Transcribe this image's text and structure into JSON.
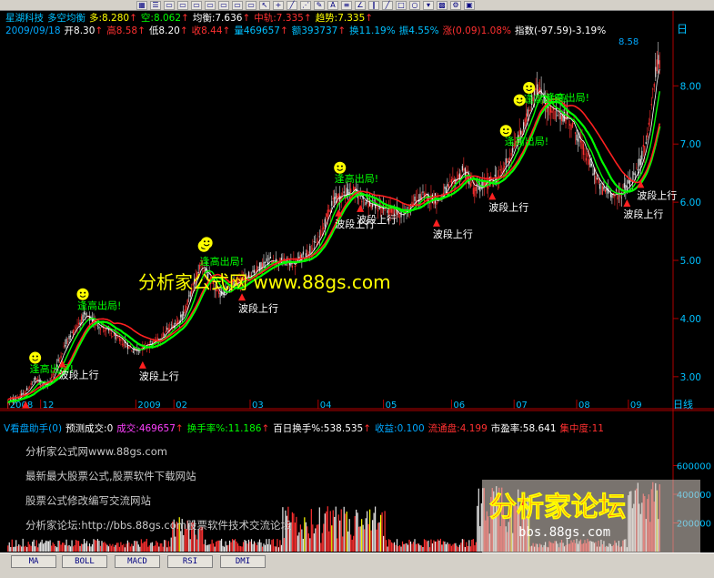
{
  "window": {
    "toolbar_icons": [
      "grid-icon",
      "list-icon",
      "window-icon",
      "window-icon",
      "window-icon",
      "window-icon",
      "window-icon",
      "window-icon",
      "window-icon",
      "pointer-icon",
      "cross-icon",
      "line-tool-icon",
      "fan-icon",
      "pen-icon",
      "text-icon",
      "channel-icon",
      "angle-icon",
      "parallel-icon",
      "line-tool-icon",
      "rect-icon",
      "circle-icon",
      "down-arrow-icon",
      "palette-icon",
      "settings-icon",
      "save-icon"
    ]
  },
  "header": {
    "row1": [
      {
        "text": "星湖科技",
        "color": "#00c0ff"
      },
      {
        "text": "多空均衡",
        "color": "#00c0ff"
      },
      {
        "text": "多:8.280",
        "color": "#ffff00"
      },
      {
        "text": "↑",
        "color": "#ff3030"
      },
      {
        "text": "空:8.062",
        "color": "#00ff00"
      },
      {
        "text": "↑",
        "color": "#ff3030"
      },
      {
        "text": "均衡:7.636",
        "color": "#ffffff"
      },
      {
        "text": "↑",
        "color": "#ff3030"
      },
      {
        "text": "中轨:7.335",
        "color": "#ff3030"
      },
      {
        "text": "↑",
        "color": "#ff3030"
      },
      {
        "text": "趋势:7.335",
        "color": "#ffff00"
      },
      {
        "text": "↑",
        "color": "#ff3030"
      }
    ],
    "row2": [
      {
        "text": "2009/09/18",
        "color": "#00a8ff"
      },
      {
        "text": "开8.30",
        "color": "#ffffff"
      },
      {
        "text": "↑",
        "color": "#ff3030"
      },
      {
        "text": "高8.58",
        "color": "#ff3030"
      },
      {
        "text": "↑",
        "color": "#ff3030"
      },
      {
        "text": "低8.20",
        "color": "#ffffff"
      },
      {
        "text": "↑",
        "color": "#ff3030"
      },
      {
        "text": "收8.44",
        "color": "#ff3030"
      },
      {
        "text": "↑",
        "color": "#ff3030"
      },
      {
        "text": "量469657",
        "color": "#00c0ff"
      },
      {
        "text": "↑",
        "color": "#ff3030"
      },
      {
        "text": "额393737",
        "color": "#00c0ff"
      },
      {
        "text": "↑",
        "color": "#ff3030"
      },
      {
        "text": "换11.19%",
        "color": "#00c0ff"
      },
      {
        "text": "振4.55%",
        "color": "#00c0ff"
      },
      {
        "text": "涨(0.09)1.08%",
        "color": "#ff3030"
      },
      {
        "text": "指数(-97.59)-3.19%",
        "color": "#ffffff"
      }
    ],
    "high_label": "8.58",
    "axis_label": "日"
  },
  "chart_data": {
    "type": "candlestick",
    "y_ticks": [
      "8.00",
      "7.00",
      "6.00",
      "5.00",
      "4.00",
      "3.00"
    ],
    "y_tick_values": [
      8,
      7,
      6,
      5,
      4,
      3
    ],
    "ylim": [
      2.45,
      8.85
    ],
    "x_ticks": [
      "2008",
      "12",
      "2009",
      "02",
      "03",
      "04",
      "05",
      "06",
      "07",
      "08",
      "09"
    ],
    "x_tick_index": [
      0,
      24,
      94,
      122,
      178,
      228,
      276,
      326,
      372,
      418,
      456
    ],
    "n_bars": 480,
    "last_bar": {
      "date": "2009/09/18",
      "open": 8.3,
      "high": 8.58,
      "low": 8.2,
      "close": 8.44
    },
    "price_path": [
      [
        0,
        2.55
      ],
      [
        18,
        2.7
      ],
      [
        30,
        2.95
      ],
      [
        45,
        2.85
      ],
      [
        65,
        3.6
      ],
      [
        85,
        4.05
      ],
      [
        110,
        3.8
      ],
      [
        140,
        3.45
      ],
      [
        165,
        3.6
      ],
      [
        195,
        4.05
      ],
      [
        215,
        4.95
      ],
      [
        235,
        4.4
      ],
      [
        260,
        4.65
      ],
      [
        290,
        5.0
      ],
      [
        320,
        4.95
      ],
      [
        345,
        5.3
      ],
      [
        362,
        6.05
      ],
      [
        385,
        6.2
      ],
      [
        405,
        5.95
      ],
      [
        440,
        5.8
      ],
      [
        460,
        6.1
      ],
      [
        480,
        6.05
      ],
      [
        508,
        6.55
      ],
      [
        520,
        6.2
      ],
      [
        548,
        6.45
      ],
      [
        575,
        7.3
      ],
      [
        588,
        8.0
      ],
      [
        605,
        7.55
      ],
      [
        625,
        7.45
      ],
      [
        640,
        6.95
      ],
      [
        660,
        6.25
      ],
      [
        680,
        6.1
      ],
      [
        700,
        6.5
      ],
      [
        712,
        7.1
      ],
      [
        722,
        8.3
      ],
      [
        726,
        8.44
      ]
    ],
    "signals": [
      {
        "text": "逢高出局!",
        "kind": "sell",
        "bar": 30
      },
      {
        "text": "波段上行",
        "kind": "buy",
        "bar": 20
      },
      {
        "text": "波段上行",
        "kind": "buy",
        "bar": 60
      },
      {
        "text": "逢高出局!",
        "kind": "sell",
        "bar": 84
      },
      {
        "text": "波段上行",
        "kind": "buy",
        "bar": 150
      },
      {
        "text": "逢高出局!",
        "kind": "sell",
        "bar": 220
      },
      {
        "text": "波段上行",
        "kind": "buy",
        "bar": 260
      },
      {
        "text": "波段上行",
        "kind": "buy",
        "bar": 368
      },
      {
        "text": "逢高出局!",
        "kind": "sell",
        "bar": 370
      },
      {
        "text": "波段上行",
        "kind": "buy",
        "bar": 393
      },
      {
        "text": "波段上行",
        "kind": "buy",
        "bar": 477
      },
      {
        "text": "波段上行",
        "kind": "buy",
        "bar": 540
      },
      {
        "text": "逢高出局!",
        "kind": "sell",
        "bar": 560
      },
      {
        "text": "逢高出局!",
        "kind": "sell",
        "bar": 580
      },
      {
        "text": "逢高出局!",
        "kind": "sell",
        "bar": 605
      },
      {
        "text": "波段上行",
        "kind": "buy",
        "bar": 690
      },
      {
        "text": "波段上行",
        "kind": "buy",
        "bar": 705
      }
    ],
    "smiley_bars": [
      30,
      84,
      218,
      222,
      370,
      555,
      570,
      580
    ],
    "watermark_text": "分析家公式网 www.88gs.com"
  },
  "volume_panel": {
    "title_items": [
      {
        "text": "V看盘助手(0)",
        "color": "#00a8ff"
      },
      {
        "text": "预测成交:0",
        "color": "#ffffff"
      },
      {
        "text": "成交:469657",
        "color": "#ff40ff"
      },
      {
        "text": "↑",
        "color": "#ff3030"
      },
      {
        "text": "换手率%:11.186",
        "color": "#00ff00"
      },
      {
        "text": "↑",
        "color": "#ff3030"
      },
      {
        "text": "百日换手%:538.535",
        "color": "#ffffff"
      },
      {
        "text": "↑",
        "color": "#ff3030"
      },
      {
        "text": "收益:0.100",
        "color": "#00a8ff"
      },
      {
        "text": "流通盘:4.199",
        "color": "#ff3030"
      },
      {
        "text": "市盈率:58.641",
        "color": "#ffffff"
      },
      {
        "text": "集中度:11",
        "color": "#ff3030"
      }
    ],
    "info_lines": [
      "分析家公式网www.88gs.com",
      "最新最大股票公式,股票软件下载网站",
      "股票公式修改编写交流网站",
      "分析家论坛:http://bbs.88gs.com股票软件技术交流论坛"
    ],
    "y_ticks": [
      "600000",
      "400000",
      "200000"
    ],
    "y_tick_values": [
      600000,
      400000,
      200000
    ],
    "vmax": 800000,
    "forum_watermark": "分析家论坛",
    "forum_url": "bbs.88gs.com"
  },
  "tabs": [
    "MA",
    "BOLL",
    "MACD",
    "RSI",
    "DMI"
  ]
}
